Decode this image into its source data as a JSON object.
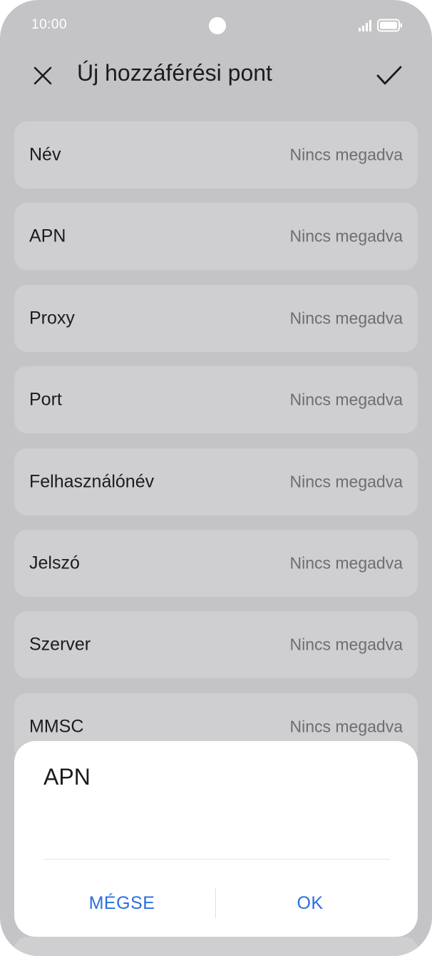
{
  "status_bar": {
    "time": "10:00"
  },
  "header": {
    "title": "Új hozzáférési pont"
  },
  "fields": [
    {
      "label": "Név",
      "value": "Nincs megadva"
    },
    {
      "label": "APN",
      "value": "Nincs megadva"
    },
    {
      "label": "Proxy",
      "value": "Nincs megadva"
    },
    {
      "label": "Port",
      "value": "Nincs megadva"
    },
    {
      "label": "Felhasználónév",
      "value": "Nincs megadva"
    },
    {
      "label": "Jelszó",
      "value": "Nincs megadva"
    },
    {
      "label": "Szerver",
      "value": "Nincs megadva"
    },
    {
      "label": "MMSC",
      "value": "Nincs megadva"
    }
  ],
  "dialog": {
    "title": "APN",
    "input_value": "",
    "cancel_label": "MÉGSE",
    "ok_label": "OK"
  },
  "colors": {
    "accent": "#2b6fde",
    "background_dimmed": "#c4c4c6",
    "row_background": "#cfcfd1",
    "dialog_background": "#ffffff"
  },
  "icons": {
    "close": "close-icon",
    "confirm": "check-icon",
    "signal": "signal-icon",
    "battery": "battery-icon"
  }
}
